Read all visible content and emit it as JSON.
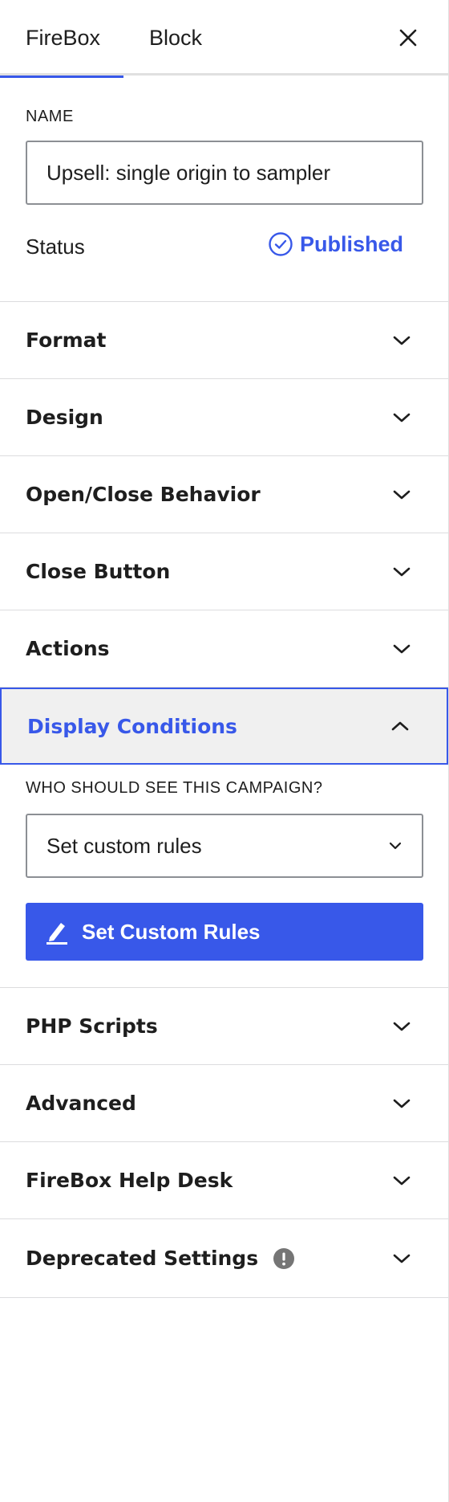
{
  "tabs": {
    "firebox": "FireBox",
    "block": "Block"
  },
  "summary": {
    "name_label": "NAME",
    "name_value": "Upsell: single origin to sampler",
    "status_label": "Status",
    "status_value": "Published"
  },
  "sections": {
    "format": "Format",
    "design": "Design",
    "open_close": "Open/Close Behavior",
    "close_button": "Close Button",
    "actions": "Actions",
    "display_conditions": "Display Conditions",
    "php_scripts": "PHP Scripts",
    "advanced": "Advanced",
    "help_desk": "FireBox Help Desk",
    "deprecated": "Deprecated Settings"
  },
  "display_conditions": {
    "question": "WHO SHOULD SEE THIS CAMPAIGN?",
    "select_value": "Set custom rules",
    "button_label": "Set Custom Rules"
  },
  "colors": {
    "accent": "#3858e9",
    "border": "#dcdcde",
    "warning_icon": "#757575"
  }
}
